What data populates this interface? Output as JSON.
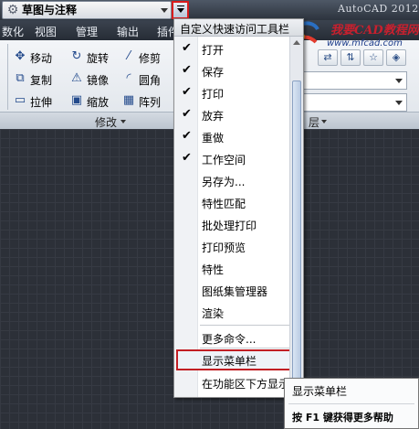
{
  "title_bar": {
    "workspace": "草图与注释",
    "app_title": "AutoCAD 2012"
  },
  "logo": {
    "brand": "我要CAD教程网",
    "url": "www.mfcad.com"
  },
  "ribbon_tabs": [
    "数化",
    "视图",
    "管理",
    "输出",
    "插件"
  ],
  "modify_panel": {
    "title": "修改",
    "tools": [
      {
        "label": "移动",
        "icon": "move-icon"
      },
      {
        "label": "旋转",
        "icon": "rotate-icon"
      },
      {
        "label": "修剪",
        "icon": "trim-icon"
      },
      {
        "label": "复制",
        "icon": "copy-icon"
      },
      {
        "label": "镜像",
        "icon": "mirror-icon"
      },
      {
        "label": "圆角",
        "icon": "fillet-icon"
      },
      {
        "label": "拉伸",
        "icon": "stretch-icon"
      },
      {
        "label": "缩放",
        "icon": "scale-icon"
      },
      {
        "label": "阵列",
        "icon": "array-icon"
      }
    ]
  },
  "layer_panel": {
    "title_fragment": "层"
  },
  "qat_menu": {
    "header": "自定义快速访问工具栏",
    "items": [
      {
        "label": "打开",
        "checked": true
      },
      {
        "label": "保存",
        "checked": true
      },
      {
        "label": "打印",
        "checked": true
      },
      {
        "label": "放弃",
        "checked": true
      },
      {
        "label": "重做",
        "checked": true
      },
      {
        "label": "工作空间",
        "checked": true
      },
      {
        "label": "另存为...",
        "checked": false
      },
      {
        "label": "特性匹配",
        "checked": false
      },
      {
        "label": "批处理打印",
        "checked": false
      },
      {
        "label": "打印预览",
        "checked": false
      },
      {
        "label": "特性",
        "checked": false
      },
      {
        "label": "图纸集管理器",
        "checked": false
      },
      {
        "label": "渲染",
        "checked": false
      }
    ],
    "more_commands": "更多命令...",
    "show_menubar": "显示菜单栏",
    "show_below_ribbon": "在功能区下方显示"
  },
  "tooltip": {
    "title": "显示菜单栏",
    "help": "按 F1 键获得更多帮助"
  },
  "colors": {
    "highlight_border": "#c21e24",
    "canvas_bg": "#2c3038",
    "ribbon_tab_bg": "#262c35"
  }
}
